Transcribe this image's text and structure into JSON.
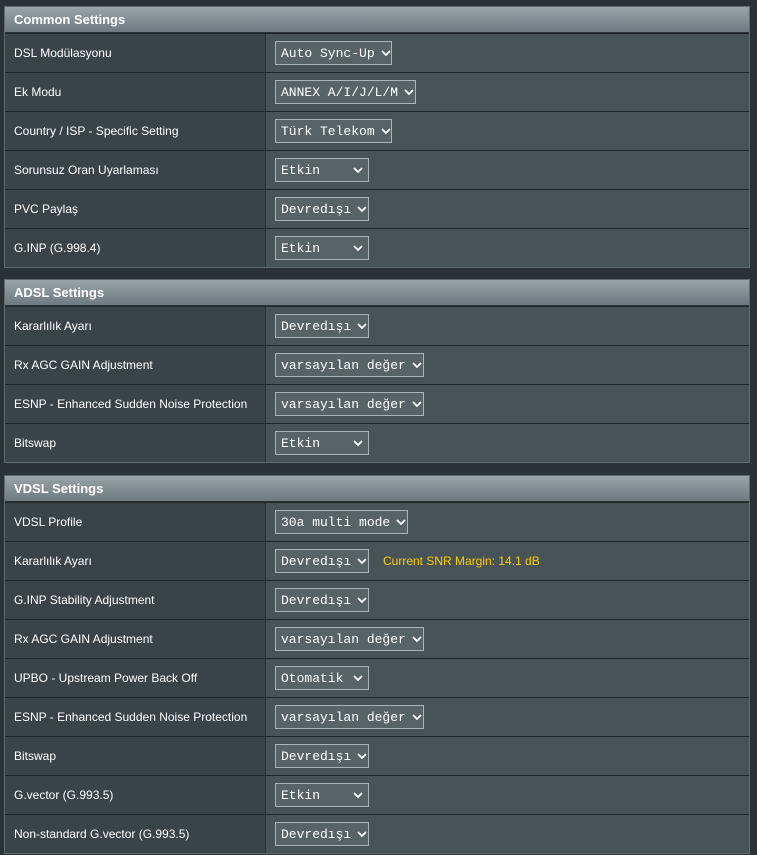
{
  "sections": [
    {
      "title": "Common Settings",
      "rows": [
        {
          "label": "DSL Modülasyonu",
          "value": "Auto Sync-Up"
        },
        {
          "label": "Ek Modu",
          "value": "ANNEX A/I/J/L/M"
        },
        {
          "label": "Country / ISP - Specific Setting",
          "value": "Türk Telekom"
        },
        {
          "label": "Sorunsuz Oran Uyarlaması",
          "value": "Etkin"
        },
        {
          "label": "PVC Paylaş",
          "value": "Devredışı"
        },
        {
          "label": "G.INP (G.998.4)",
          "value": "Etkin"
        }
      ]
    },
    {
      "title": "ADSL Settings",
      "rows": [
        {
          "label": "Kararlılık Ayarı",
          "value": "Devredışı"
        },
        {
          "label": "Rx AGC GAIN Adjustment",
          "value": "varsayılan değer"
        },
        {
          "label": "ESNP - Enhanced Sudden Noise Protection",
          "value": "varsayılan değer"
        },
        {
          "label": "Bitswap",
          "value": "Etkin"
        }
      ]
    },
    {
      "title": "VDSL Settings",
      "rows": [
        {
          "label": "VDSL Profile",
          "value": "30a multi mode"
        },
        {
          "label": "Kararlılık Ayarı",
          "value": "Devredışı",
          "note": "Current SNR Margin: 14.1 dB"
        },
        {
          "label": "G.INP Stability Adjustment",
          "value": "Devredışı"
        },
        {
          "label": "Rx AGC GAIN Adjustment",
          "value": "varsayılan değer"
        },
        {
          "label": "UPBO - Upstream Power Back Off",
          "value": "Otomatik"
        },
        {
          "label": "ESNP - Enhanced Sudden Noise Protection",
          "value": "varsayılan değer"
        },
        {
          "label": "Bitswap",
          "value": "Devredışı"
        },
        {
          "label": "G.vector (G.993.5)",
          "value": "Etkin"
        },
        {
          "label": "Non-standard G.vector (G.993.5)",
          "value": "Devredışı"
        }
      ]
    }
  ],
  "icons": {
    "dropdown": "chevron-down-icon"
  },
  "colors": {
    "note": "#ffcc00",
    "header": "#7e8a8f",
    "label_bg": "#3a4448",
    "value_bg": "#475357"
  }
}
